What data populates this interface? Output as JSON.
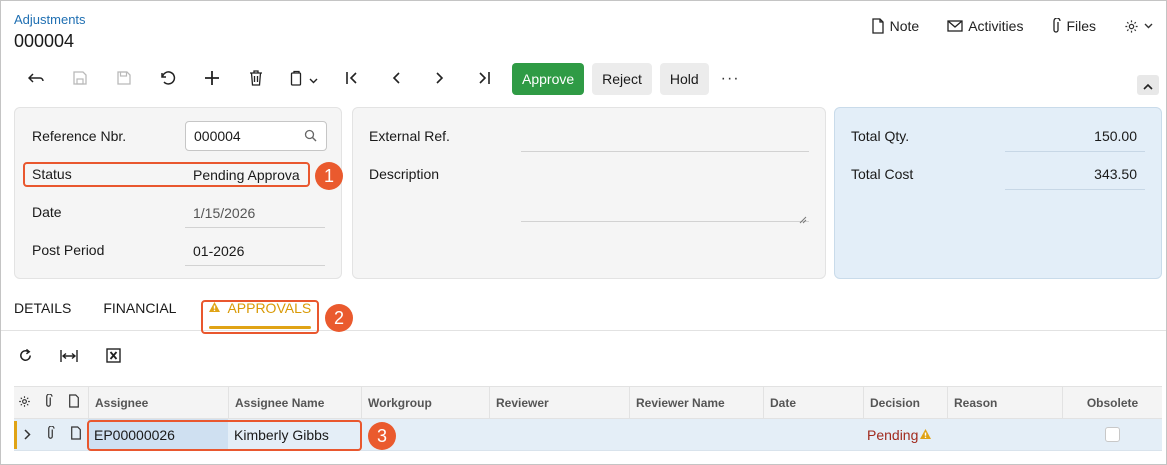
{
  "header": {
    "breadcrumb": "Adjustments",
    "title": "000004",
    "actions": [
      {
        "label": "Note",
        "icon": "note-icon"
      },
      {
        "label": "Activities",
        "icon": "mail-icon"
      },
      {
        "label": "Files",
        "icon": "paperclip-icon"
      }
    ],
    "settings_icon": "gear-icon"
  },
  "toolbar": {
    "icons": [
      "back-arrow-icon",
      "save-close-icon",
      "save-icon",
      "undo-icon",
      "add-icon",
      "delete-icon",
      "copy-paste-icon",
      "first-record-icon",
      "previous-record-icon",
      "next-record-icon",
      "last-record-icon"
    ],
    "approve_label": "Approve",
    "reject_label": "Reject",
    "hold_label": "Hold",
    "more_label": "···"
  },
  "summary": {
    "reference_label": "Reference Nbr.",
    "reference_value": "000004",
    "status_label": "Status",
    "status_value": "Pending Approva",
    "date_label": "Date",
    "date_value": "1/15/2026",
    "post_period_label": "Post Period",
    "post_period_value": "01-2026",
    "external_ref_label": "External Ref.",
    "external_ref_value": "",
    "description_label": "Description",
    "description_value": "",
    "total_qty_label": "Total Qty.",
    "total_qty_value": "150.00",
    "total_cost_label": "Total Cost",
    "total_cost_value": "343.50"
  },
  "callouts": [
    "1",
    "2",
    "3"
  ],
  "tabs": {
    "details": "DETAILS",
    "financial": "FINANCIAL",
    "approvals": "APPROVALS"
  },
  "grid": {
    "columns": [
      "Assignee",
      "Assignee Name",
      "Workgroup",
      "Reviewer",
      "Reviewer Name",
      "Date",
      "Decision",
      "Reason",
      "Obsolete"
    ],
    "rows": [
      {
        "assignee": "EP00000026",
        "assignee_name": "Kimberly Gibbs",
        "workgroup": "",
        "reviewer": "",
        "reviewer_name": "",
        "date": "",
        "decision": "Pending",
        "reason": "",
        "obsolete": false
      }
    ]
  },
  "colors": {
    "accent": "#1f6fb2",
    "approve": "#2f9b45",
    "highlight": "#e9572e",
    "warning": "#e0a315",
    "pending": "#a12a1e"
  }
}
